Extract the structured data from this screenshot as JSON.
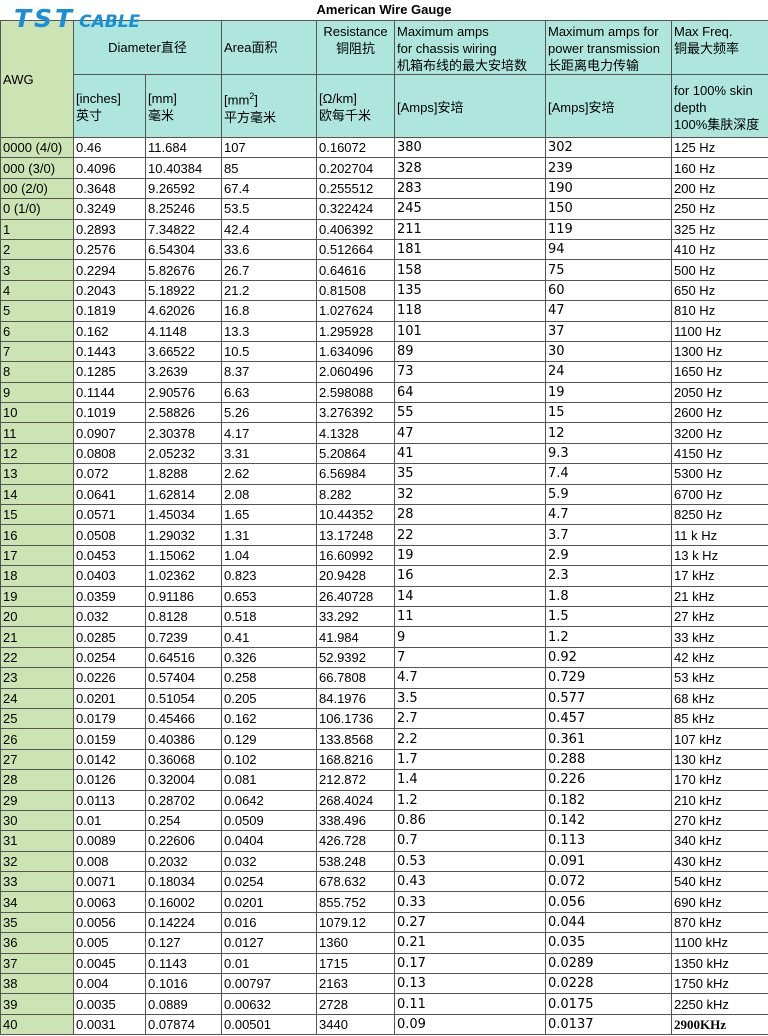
{
  "title": "American Wire Gauge",
  "logo": {
    "tst": "TST",
    "cable": "CABLE"
  },
  "headers": {
    "awg": "AWG",
    "diameter": "Diameter直径",
    "area": "Area面积",
    "resistance_en": "Resistance",
    "resistance_zh": "铜阻抗",
    "chassis_en": "Maximum amps for chassis wiring",
    "chassis_zh": "机箱布线的最大安培数",
    "power_en": "Maximum amps for power transmission",
    "power_zh": "长距离电力传输",
    "freq_en": "Max Freq.",
    "freq_zh": "铜最大频率",
    "inches_en": "[inches]",
    "inches_zh": "英寸",
    "mm_en": "[mm]",
    "mm_zh": "毫米",
    "mm2_en": "[mm",
    "mm2_sup": "2",
    "mm2_close": "]",
    "mm2_zh": "平方毫米",
    "ohm_en": "[Ω/km]",
    "ohm_zh": "欧每千米",
    "amps_chassis": "[Amps]安培",
    "amps_power": "[Amps]安培",
    "skin_en": "for 100% skin depth",
    "skin_zh": "100%集肤深度"
  },
  "rows": [
    [
      "0000 (4/0)",
      "0.46",
      "11.684",
      "107",
      "0.16072",
      "380",
      "302",
      "125 Hz"
    ],
    [
      "000 (3/0)",
      "0.4096",
      "10.40384",
      "85",
      "0.202704",
      "328",
      "239",
      "160 Hz"
    ],
    [
      "00 (2/0)",
      "0.3648",
      "9.26592",
      "67.4",
      "0.255512",
      "283",
      "190",
      "200 Hz"
    ],
    [
      "0 (1/0)",
      "0.3249",
      "8.25246",
      "53.5",
      "0.322424",
      "245",
      "150",
      "250 Hz"
    ],
    [
      "1",
      "0.2893",
      "7.34822",
      "42.4",
      "0.406392",
      "211",
      "119",
      "325 Hz"
    ],
    [
      "2",
      "0.2576",
      "6.54304",
      "33.6",
      "0.512664",
      "181",
      "94",
      "410 Hz"
    ],
    [
      "3",
      "0.2294",
      "5.82676",
      "26.7",
      "0.64616",
      "158",
      "75",
      "500 Hz"
    ],
    [
      "4",
      "0.2043",
      "5.18922",
      "21.2",
      "0.81508",
      "135",
      "60",
      "650 Hz"
    ],
    [
      "5",
      "0.1819",
      "4.62026",
      "16.8",
      "1.027624",
      "118",
      "47",
      "810 Hz"
    ],
    [
      "6",
      "0.162",
      "4.1148",
      "13.3",
      "1.295928",
      "101",
      "37",
      "1100 Hz"
    ],
    [
      "7",
      "0.1443",
      "3.66522",
      "10.5",
      "1.634096",
      "89",
      "30",
      "1300 Hz"
    ],
    [
      "8",
      "0.1285",
      "3.2639",
      "8.37",
      "2.060496",
      "73",
      "24",
      "1650 Hz"
    ],
    [
      "9",
      "0.1144",
      "2.90576",
      "6.63",
      "2.598088",
      "64",
      "19",
      "2050 Hz"
    ],
    [
      "10",
      "0.1019",
      "2.58826",
      "5.26",
      "3.276392",
      "55",
      "15",
      "2600 Hz"
    ],
    [
      "11",
      "0.0907",
      "2.30378",
      "4.17",
      "4.1328",
      "47",
      "12",
      "3200 Hz"
    ],
    [
      "12",
      "0.0808",
      "2.05232",
      "3.31",
      "5.20864",
      "41",
      "9.3",
      "4150 Hz"
    ],
    [
      "13",
      "0.072",
      "1.8288",
      "2.62",
      "6.56984",
      "35",
      "7.4",
      "5300 Hz"
    ],
    [
      "14",
      "0.0641",
      "1.62814",
      "2.08",
      "8.282",
      "32",
      "5.9",
      "6700 Hz"
    ],
    [
      "15",
      "0.0571",
      "1.45034",
      "1.65",
      "10.44352",
      "28",
      "4.7",
      "8250 Hz"
    ],
    [
      "16",
      "0.0508",
      "1.29032",
      "1.31",
      "13.17248",
      "22",
      "3.7",
      "11 k Hz"
    ],
    [
      "17",
      "0.0453",
      "1.15062",
      "1.04",
      "16.60992",
      "19",
      "2.9",
      "13 k Hz"
    ],
    [
      "18",
      "0.0403",
      "1.02362",
      "0.823",
      "20.9428",
      "16",
      "2.3",
      "17 kHz"
    ],
    [
      "19",
      "0.0359",
      "0.91186",
      "0.653",
      "26.40728",
      "14",
      "1.8",
      "21 kHz"
    ],
    [
      "20",
      "0.032",
      "0.8128",
      "0.518",
      "33.292",
      "11",
      "1.5",
      "27 kHz"
    ],
    [
      "21",
      "0.0285",
      "0.7239",
      "0.41",
      "41.984",
      "9",
      "1.2",
      "33 kHz"
    ],
    [
      "22",
      "0.0254",
      "0.64516",
      "0.326",
      "52.9392",
      "7",
      "0.92",
      "42 kHz"
    ],
    [
      "23",
      "0.0226",
      "0.57404",
      "0.258",
      "66.7808",
      "4.7",
      "0.729",
      "53 kHz"
    ],
    [
      "24",
      "0.0201",
      "0.51054",
      "0.205",
      "84.1976",
      "3.5",
      "0.577",
      "68 kHz"
    ],
    [
      "25",
      "0.0179",
      "0.45466",
      "0.162",
      "106.1736",
      "2.7",
      "0.457",
      "85 kHz"
    ],
    [
      "26",
      "0.0159",
      "0.40386",
      "0.129",
      "133.8568",
      "2.2",
      "0.361",
      "107 kHz"
    ],
    [
      "27",
      "0.0142",
      "0.36068",
      "0.102",
      "168.8216",
      "1.7",
      "0.288",
      "130 kHz"
    ],
    [
      "28",
      "0.0126",
      "0.32004",
      "0.081",
      "212.872",
      "1.4",
      "0.226",
      "170 kHz"
    ],
    [
      "29",
      "0.0113",
      "0.28702",
      "0.0642",
      "268.4024",
      "1.2",
      "0.182",
      "210 kHz"
    ],
    [
      "30",
      "0.01",
      "0.254",
      "0.0509",
      "338.496",
      "0.86",
      "0.142",
      "270 kHz"
    ],
    [
      "31",
      "0.0089",
      "0.22606",
      "0.0404",
      "426.728",
      "0.7",
      "0.113",
      "340 kHz"
    ],
    [
      "32",
      "0.008",
      "0.2032",
      "0.032",
      "538.248",
      "0.53",
      "0.091",
      "430 kHz"
    ],
    [
      "33",
      "0.0071",
      "0.18034",
      "0.0254",
      "678.632",
      "0.43",
      "0.072",
      "540 kHz"
    ],
    [
      "34",
      "0.0063",
      "0.16002",
      "0.0201",
      "855.752",
      "0.33",
      "0.056",
      "690 kHz"
    ],
    [
      "35",
      "0.0056",
      "0.14224",
      "0.016",
      "1079.12",
      "0.27",
      "0.044",
      "870 kHz"
    ],
    [
      "36",
      "0.005",
      "0.127",
      "0.0127",
      "1360",
      "0.21",
      "0.035",
      "1100 kHz"
    ],
    [
      "37",
      "0.0045",
      "0.1143",
      "0.01",
      "1715",
      "0.17",
      "0.0289",
      "1350 kHz"
    ],
    [
      "38",
      "0.004",
      "0.1016",
      "0.00797",
      "2163",
      "0.13",
      "0.0228",
      "1750 kHz"
    ],
    [
      "39",
      "0.0035",
      "0.0889",
      "0.00632",
      "2728",
      "0.11",
      "0.0175",
      "2250 kHz"
    ],
    [
      "40",
      "0.0031",
      "0.07874",
      "0.00501",
      "3440",
      "0.09",
      "0.0137",
      "2900KHz"
    ]
  ],
  "colors": {
    "header_bg": "#aee6de",
    "awg_bg": "#cce3b4",
    "logo": "#1a8fd6"
  }
}
